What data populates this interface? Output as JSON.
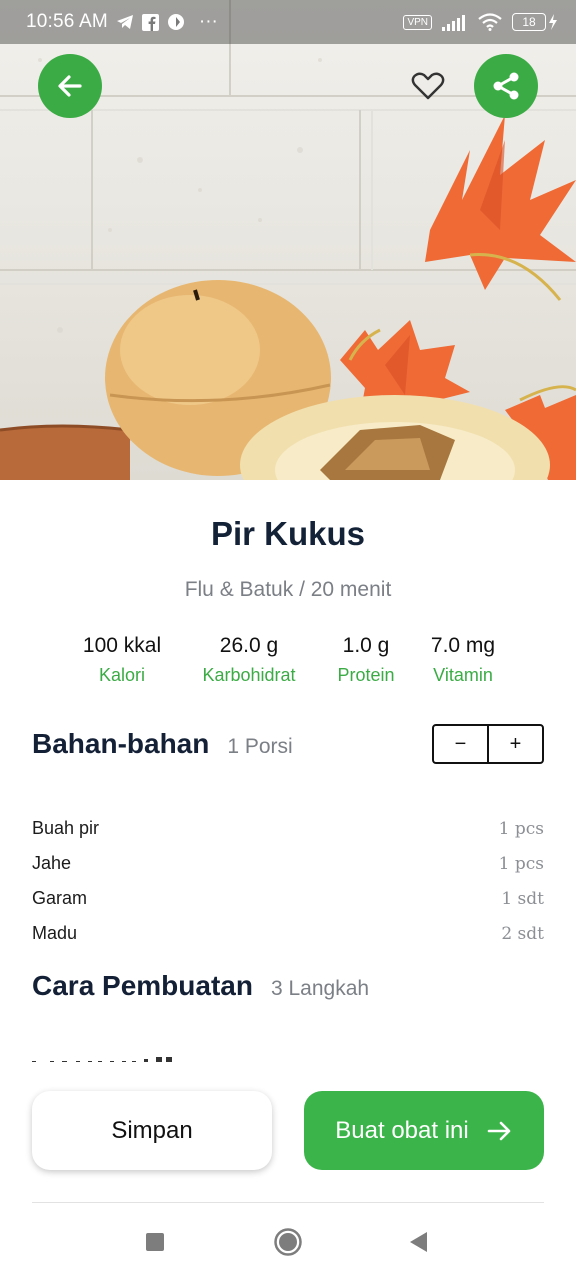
{
  "status_bar": {
    "time": "10:56 AM",
    "dots": "···",
    "vpn": "VPN",
    "battery": "18",
    "icons": [
      "telegram-icon",
      "facebook-icon",
      "app-icon",
      "signal-icon",
      "wifi-icon",
      "battery-icon",
      "charging-icon"
    ]
  },
  "hero": {
    "icons": [
      "back-arrow-icon",
      "heart-outline-icon",
      "share-icon"
    ],
    "accent": "#3bac45"
  },
  "recipe": {
    "title": "Pir Kukus",
    "subtitle": "Flu & Batuk / 20 menit"
  },
  "nutrition": [
    {
      "value": "100 kkal",
      "label": "Kalori"
    },
    {
      "value": "26.0 g",
      "label": "Karbohidrat"
    },
    {
      "value": "1.0 g",
      "label": "Protein"
    },
    {
      "value": "7.0 mg",
      "label": "Vitamin"
    }
  ],
  "ingredients_section": {
    "heading": "Bahan-bahan",
    "portion": "1 Porsi",
    "minus": "−",
    "plus": "+"
  },
  "ingredients": [
    {
      "name": "Buah pir",
      "qty": "1 pcs"
    },
    {
      "name": "Jahe",
      "qty": "1 pcs"
    },
    {
      "name": "Garam",
      "qty": "1 sdt"
    },
    {
      "name": "Madu",
      "qty": "2 sdt"
    }
  ],
  "steps_section": {
    "heading": "Cara Pembuatan",
    "count": "3 Langkah"
  },
  "actions": {
    "save": "Simpan",
    "make": "Buat obat ini",
    "make_color": "#3bb44a"
  },
  "nav_bar": {
    "icons": [
      "recents-square-icon",
      "home-circle-icon",
      "back-triangle-icon"
    ]
  }
}
